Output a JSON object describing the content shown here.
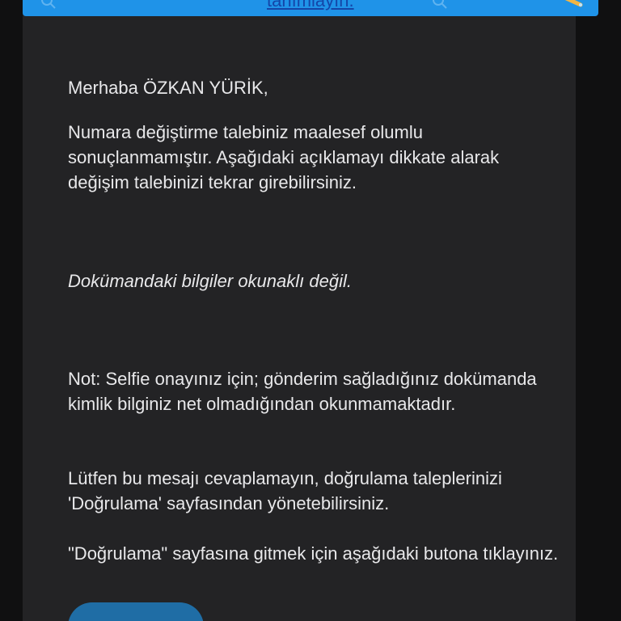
{
  "banner": {
    "link_text": "tanımlayın.",
    "color": "#1f93e8"
  },
  "email": {
    "greeting": "Merhaba ÖZKAN YÜRİK,",
    "para1": "Numara değiştirme talebiniz maalesef olumlu sonuçlanmamıştır. Aşağıdaki açıklamayı dikkate alarak değişim talebinizi tekrar girebilirsiniz.",
    "reason": "Dokümandaki bilgiler okunaklı değil.",
    "note": "Not: Selfie onayınız için; gönderim sağladığınız dokümanda kimlik bilginiz net olmadığından okunmamaktadır.",
    "para2": "Lütfen bu mesajı cevaplamayın, doğrulama taleplerinizi 'Doğrulama' sayfasından yönetebilirsiniz.",
    "para3": "\"Doğrulama\" sayfasına gitmek için aşağıdaki butona tıklayınız."
  },
  "button": {
    "label": "",
    "color": "#1f6da5"
  }
}
